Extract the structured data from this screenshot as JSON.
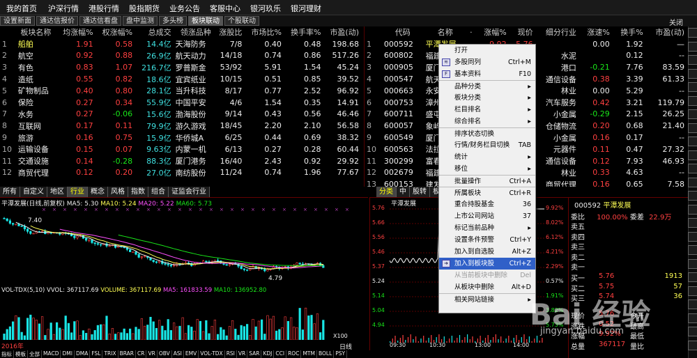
{
  "menu": [
    "我的首页",
    "沪深行情",
    "港股行情",
    "股指期货",
    "业务公告",
    "客服中心",
    "银河玖乐",
    "银河理财"
  ],
  "tabs": [
    "设置新面",
    "通达信报价",
    "通达信看盘",
    "盘中监测",
    "多头榜",
    "板块联动",
    "个股联动"
  ],
  "active_tab": "板块联动",
  "close_label": "关闭",
  "left_table": {
    "headers": [
      "",
      "板块名称",
      "均涨幅%",
      "权涨幅%",
      "总成交",
      "领涨品种",
      "涨股比",
      "市场比%",
      "换手率%",
      "市盈(动)"
    ],
    "rows": [
      [
        "1",
        "船舶",
        "1.91",
        "0.58",
        "14.4亿",
        "天海防务",
        "7/8",
        "0.40",
        "0.48",
        "198.68"
      ],
      [
        "2",
        "航空",
        "0.92",
        "0.88",
        "26.9亿",
        "航天动力",
        "14/18",
        "0.74",
        "0.86",
        "517.26"
      ],
      [
        "3",
        "有色",
        "0.83",
        "1.07",
        "216.7亿",
        "罗普斯金",
        "53/92",
        "5.91",
        "1.54",
        "45.24"
      ],
      [
        "4",
        "造纸",
        "0.55",
        "0.82",
        "18.6亿",
        "宜宾纸业",
        "10/15",
        "0.51",
        "0.85",
        "39.52"
      ],
      [
        "5",
        "矿物制品",
        "0.40",
        "0.80",
        "28.1亿",
        "当升科技",
        "8/17",
        "0.77",
        "2.52",
        "96.92"
      ],
      [
        "6",
        "保险",
        "0.27",
        "0.34",
        "55.9亿",
        "中国平安",
        "4/6",
        "1.54",
        "0.35",
        "14.91"
      ],
      [
        "7",
        "水务",
        "0.27",
        "-0.06",
        "15.6亿",
        "渤海股份",
        "9/14",
        "0.43",
        "0.56",
        "46.46"
      ],
      [
        "8",
        "互联网",
        "0.17",
        "0.11",
        "79.9亿",
        "游久游戏",
        "18/45",
        "2.20",
        "2.10",
        "56.58"
      ],
      [
        "9",
        "旅游",
        "0.16",
        "0.75",
        "15.9亿",
        "华侨城A",
        "6/25",
        "0.44",
        "0.69",
        "38.32"
      ],
      [
        "10",
        "运输设备",
        "0.15",
        "0.07",
        "9.63亿",
        "内蒙一机",
        "6/13",
        "0.27",
        "0.28",
        "60.44"
      ],
      [
        "11",
        "交通设施",
        "0.14",
        "-0.28",
        "88.3亿",
        "厦门港务",
        "16/40",
        "2.43",
        "0.92",
        "29.92"
      ],
      [
        "12",
        "商贸代理",
        "0.12",
        "0.20",
        "27.0亿",
        "南纺股份",
        "11/24",
        "0.74",
        "1.96",
        "77.67"
      ]
    ]
  },
  "right_table": {
    "headers": [
      "",
      "代码",
      "名称",
      "·",
      "涨幅%",
      "现价",
      "细分行业",
      "涨速%",
      "换手%",
      "市盈(动)"
    ],
    "rows": [
      [
        "1",
        "000592",
        "平潭发展",
        "",
        "9.92",
        "5.76",
        "",
        "0.00",
        "1.92",
        "—"
      ],
      [
        "2",
        "600802",
        "福建水",
        "",
        "",
        "",
        "水泥",
        "",
        "0.12",
        "--"
      ],
      [
        "3",
        "000905",
        "厦门港",
        "",
        "",
        "",
        "港口",
        "-0.21",
        "7.76",
        "83.59"
      ],
      [
        "4",
        "000547",
        "航天发",
        "",
        "",
        "",
        "通信设备",
        "0.38",
        "3.39",
        "61.33"
      ],
      [
        "5",
        "000663",
        "永安林",
        "",
        "",
        "",
        "林业",
        "0.00",
        "5.29",
        "--"
      ],
      [
        "6",
        "000753",
        "漳州发",
        "",
        "",
        "",
        "汽车服务",
        "0.42",
        "3.21",
        "119.79"
      ],
      [
        "7",
        "600711",
        "盛屯矿",
        "",
        "",
        "",
        "小金属",
        "-0.29",
        "2.15",
        "26.25"
      ],
      [
        "8",
        "600057",
        "象屿股",
        "",
        "",
        "",
        "仓储物流",
        "0.20",
        "0.68",
        "21.40"
      ],
      [
        "9",
        "600549",
        "厦门钨",
        "",
        "",
        "",
        "小金属",
        "0.16",
        "0.17",
        "--"
      ],
      [
        "10",
        "600563",
        "法拉电",
        "",
        "",
        "",
        "元器件",
        "0.11",
        "0.47",
        "27.32"
      ],
      [
        "11",
        "300299",
        "富春股",
        "",
        "",
        "",
        "通信设备",
        "0.12",
        "7.93",
        "46.93"
      ],
      [
        "12",
        "002679",
        "福建金",
        "",
        "",
        "",
        "林业",
        "0.33",
        "4.63",
        "--"
      ],
      [
        "13",
        "600153",
        "建发股",
        "",
        "",
        "",
        "商贸代理",
        "0.16",
        "0.65",
        "7.58"
      ]
    ]
  },
  "bottom_tabs_left": [
    "所有",
    "自定义",
    "地区",
    "行业",
    "概念",
    "风格",
    "指数",
    "组合",
    "证监会行业"
  ],
  "bottom_tabs_left_sel": "行业",
  "bottom_tabs_right": [
    "分类",
    "中",
    "股转",
    "板块指数",
    "自选",
    "板块",
    "自定"
  ],
  "chart_info": {
    "title": "平潭发展(日线,前复权)",
    "ma5": "MA5: 5.30",
    "ma10": "MA10: 5.24",
    "ma20": "MA20: 5.22",
    "ma60": "MA60: 5.73",
    "high_label": "7.40",
    "low_label": "4.79",
    "vol_info": "VOL-TDX(5,10)  VVOL: 367117.69",
    "volume": "VOLUME: 367117.69",
    "vol_ma5": "MA5: 161833.59",
    "vol_ma10": "MA10: 136952.80",
    "date": "2016年",
    "vol_unit": "X100",
    "period": "日线"
  },
  "intraday": {
    "title": "平潭发展",
    "prices": [
      "5.76",
      "5.66",
      "5.56",
      "5.46",
      "5.37",
      "5.24",
      "5.14",
      "5.04",
      "4.94"
    ],
    "pcts": [
      "9.92%",
      "8.02%",
      "6.12%",
      "4.21%",
      "2.29%",
      "0.57%",
      "1.91%",
      "3.82%",
      "5.73%"
    ],
    "times": [
      "09:30",
      "10:30",
      "13:00",
      "14:00"
    ]
  },
  "quote": {
    "code": "000592",
    "name": "平潭发展",
    "weibi_label": "委比",
    "weibi": "100.00%",
    "weicha_label": "委差",
    "weicha": "22.9万",
    "sells": [
      "卖五",
      "卖四",
      "卖三",
      "卖二",
      "卖一"
    ],
    "buys": [
      [
        "买一",
        "5.76",
        "1913"
      ],
      [
        "买二",
        "5.75",
        "57"
      ],
      [
        "买三",
        "5.74",
        "36"
      ]
    ],
    "rows": [
      [
        "现价",
        "5.76",
        "今开",
        ""
      ],
      [
        "涨跌",
        "0.52",
        "最高",
        ""
      ],
      [
        "涨幅",
        "9.92%",
        "最低",
        ""
      ],
      [
        "总量",
        "367117",
        "量比",
        ""
      ]
    ]
  },
  "context_menu": [
    {
      "label": "打开",
      "key": ""
    },
    {
      "label": "多股同列",
      "key": "Ctrl+M",
      "icon": "≋"
    },
    {
      "label": "基本资料",
      "key": "F10",
      "icon": "F"
    },
    {
      "label": "品种分类",
      "key": "▸",
      "sep": true
    },
    {
      "label": "板块分类",
      "key": "▸"
    },
    {
      "label": "栏目排名",
      "key": "▸"
    },
    {
      "label": "综合排名",
      "key": "▸"
    },
    {
      "label": "排序状态切换",
      "key": "",
      "sep": true
    },
    {
      "label": "行情/财务栏目切换",
      "key": "TAB"
    },
    {
      "label": "统计",
      "key": "▸"
    },
    {
      "label": "移位",
      "key": "▸"
    },
    {
      "label": "批量操作",
      "key": "Ctrl+A",
      "sep": true
    },
    {
      "label": "所属板块",
      "key": "Ctrl+R",
      "sep": true
    },
    {
      "label": "重合持股基金",
      "key": "36"
    },
    {
      "label": "上市公司网站",
      "key": "37"
    },
    {
      "label": "标记当前品种",
      "key": "▸"
    },
    {
      "label": "设置条件预警",
      "key": "Ctrl+Y"
    },
    {
      "label": "加入到自选股",
      "key": "Alt+Z"
    },
    {
      "label": "加入到板块股",
      "key": "Ctrl+Z",
      "hl": true,
      "icon": "➜"
    },
    {
      "label": "从当前板块中删除",
      "key": "Del",
      "dis": true
    },
    {
      "label": "从板块中删除",
      "key": "Alt+D"
    },
    {
      "label": "相关网站链接",
      "key": "▸",
      "sep": true
    }
  ],
  "bottom_indicators": [
    "指标",
    "模板",
    "全部",
    "MACD",
    "DMI",
    "DMA",
    "FSL",
    "TRIX",
    "BRAR",
    "CR",
    "VR",
    "OBV",
    "ASI",
    "EMV",
    "VOL-TDX",
    "RSI",
    "VR",
    "SAR",
    "KDJ",
    "CCI",
    "ROC",
    "MTM",
    "BOLL",
    "PSY"
  ],
  "watermark": "Bai 经验",
  "watermark_url": "jingyan.baidu.com",
  "colors": {
    "up": "#ff4040",
    "down": "#19e619",
    "yellow": "#ffff54",
    "highlight": "#3060c8"
  }
}
